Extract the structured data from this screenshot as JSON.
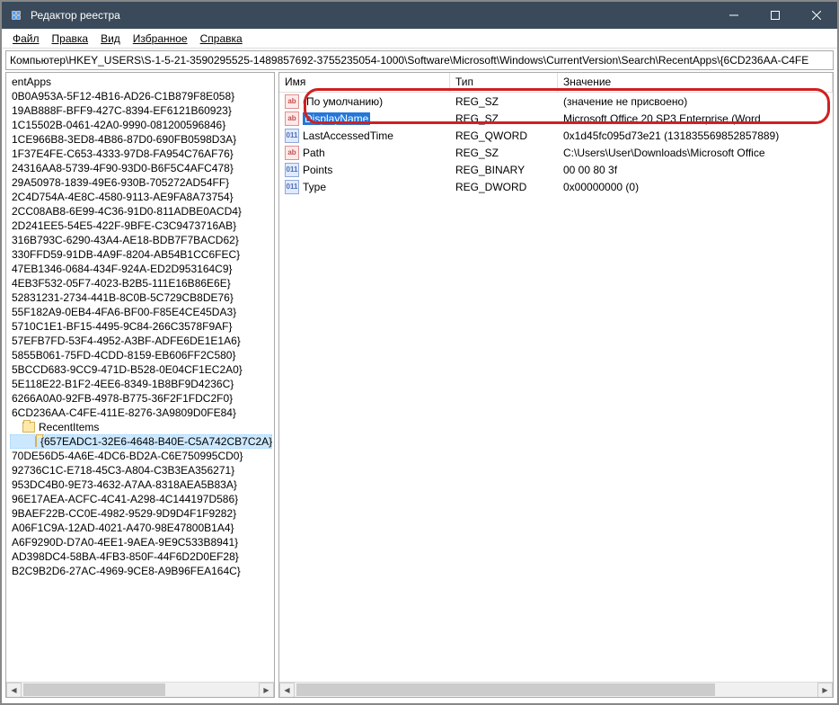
{
  "window": {
    "title": "Редактор реестра"
  },
  "menu": {
    "file": "Файл",
    "edit": "Правка",
    "view": "Вид",
    "favorites": "Избранное",
    "help": "Справка"
  },
  "address": "Компьютер\\HKEY_USERS\\S-1-5-21-3590295525-1489857692-3755235054-1000\\Software\\Microsoft\\Windows\\CurrentVersion\\Search\\RecentApps\\{6CD236AA-C4FE",
  "tree": {
    "items": [
      {
        "label": "entApps",
        "indent": 0
      },
      {
        "label": "0B0A953A-5F12-4B16-AD26-C1B879F8E058}",
        "indent": 0
      },
      {
        "label": "19AB888F-BFF9-427C-8394-EF6121B60923}",
        "indent": 0
      },
      {
        "label": "1C15502B-0461-42A0-9990-081200596846}",
        "indent": 0
      },
      {
        "label": "1CE966B8-3ED8-4B86-87D0-690FB0598D3A}",
        "indent": 0
      },
      {
        "label": "1F37E4FE-C653-4333-97D8-FA954C76AF76}",
        "indent": 0
      },
      {
        "label": "24316AA8-5739-4F90-93D0-B6F5C4AFC478}",
        "indent": 0
      },
      {
        "label": "29A50978-1839-49E6-930B-705272AD54FF}",
        "indent": 0
      },
      {
        "label": "2C4D754A-4E8C-4580-9113-AE9FA8A73754}",
        "indent": 0
      },
      {
        "label": "2CC08AB8-6E99-4C36-91D0-811ADBE0ACD4}",
        "indent": 0
      },
      {
        "label": "2D241EE5-54E5-422F-9BFE-C3C9473716AB}",
        "indent": 0
      },
      {
        "label": "316B793C-6290-43A4-AE18-BDB7F7BACD62}",
        "indent": 0
      },
      {
        "label": "330FFD59-91DB-4A9F-8204-AB54B1CC6FEC}",
        "indent": 0
      },
      {
        "label": "47EB1346-0684-434F-924A-ED2D953164C9}",
        "indent": 0
      },
      {
        "label": "4EB3F532-05F7-4023-B2B5-111E16B86E6E}",
        "indent": 0
      },
      {
        "label": "52831231-2734-441B-8C0B-5C729CB8DE76}",
        "indent": 0
      },
      {
        "label": "55F182A9-0EB4-4FA6-BF00-F85E4CE45DA3}",
        "indent": 0
      },
      {
        "label": "5710C1E1-BF15-4495-9C84-266C3578F9AF}",
        "indent": 0
      },
      {
        "label": "57EFB7FD-53F4-4952-A3BF-ADFE6DE1E1A6}",
        "indent": 0
      },
      {
        "label": "5855B061-75FD-4CDD-8159-EB606FF2C580}",
        "indent": 0
      },
      {
        "label": "5BCCD683-9CC9-471D-B528-0E04CF1EC2A0}",
        "indent": 0
      },
      {
        "label": "5E118E22-B1F2-4EE6-8349-1B8BF9D4236C}",
        "indent": 0
      },
      {
        "label": "6266A0A0-92FB-4978-B775-36F2F1FDC2F0}",
        "indent": 0
      },
      {
        "label": "6CD236AA-C4FE-411E-8276-3A9809D0FE84}",
        "indent": 0
      },
      {
        "label": "RecentItems",
        "indent": 1,
        "folder": true
      },
      {
        "label": "{657EADC1-32E6-4648-B40E-C5A742CB7C2A}",
        "indent": 2,
        "folder": true,
        "selected": true
      },
      {
        "label": "70DE56D5-4A6E-4DC6-BD2A-C6E750995CD0}",
        "indent": 0
      },
      {
        "label": "92736C1C-E718-45C3-A804-C3B3EA356271}",
        "indent": 0
      },
      {
        "label": "953DC4B0-9E73-4632-A7AA-8318AEA5B83A}",
        "indent": 0
      },
      {
        "label": "96E17AEA-ACFC-4C41-A298-4C144197D586}",
        "indent": 0
      },
      {
        "label": "9BAEF22B-CC0E-4982-9529-9D9D4F1F9282}",
        "indent": 0
      },
      {
        "label": "A06F1C9A-12AD-4021-A470-98E47800B1A4}",
        "indent": 0
      },
      {
        "label": "A6F9290D-D7A0-4EE1-9AEA-9E9C533B8941}",
        "indent": 0
      },
      {
        "label": "AD398DC4-58BA-4FB3-850F-44F6D2D0EF28}",
        "indent": 0
      },
      {
        "label": "B2C9B2D6-27AC-4969-9CE8-A9B96FEA164C}",
        "indent": 0
      }
    ]
  },
  "list": {
    "cols": {
      "name": "Имя",
      "type": "Тип",
      "value": "Значение"
    },
    "rows": [
      {
        "icon": "str",
        "name": "(По умолчанию)",
        "type": "REG_SZ",
        "value": "(значение не присвоено)"
      },
      {
        "icon": "str",
        "name": "DisplayName",
        "type": "REG_SZ",
        "value": "Microsoft Office 20     SP3 Enterprise (Word",
        "selected": true
      },
      {
        "icon": "bin",
        "name": "LastAccessedTime",
        "type": "REG_QWORD",
        "value": "0x1d45fc095d73e21 (131835569852857889)"
      },
      {
        "icon": "str",
        "name": "Path",
        "type": "REG_SZ",
        "value": "C:\\Users\\User\\Downloads\\Microsoft Office"
      },
      {
        "icon": "bin",
        "name": "Points",
        "type": "REG_BINARY",
        "value": "00 00 80 3f"
      },
      {
        "icon": "bin",
        "name": "Type",
        "type": "REG_DWORD",
        "value": "0x00000000 (0)"
      }
    ]
  }
}
